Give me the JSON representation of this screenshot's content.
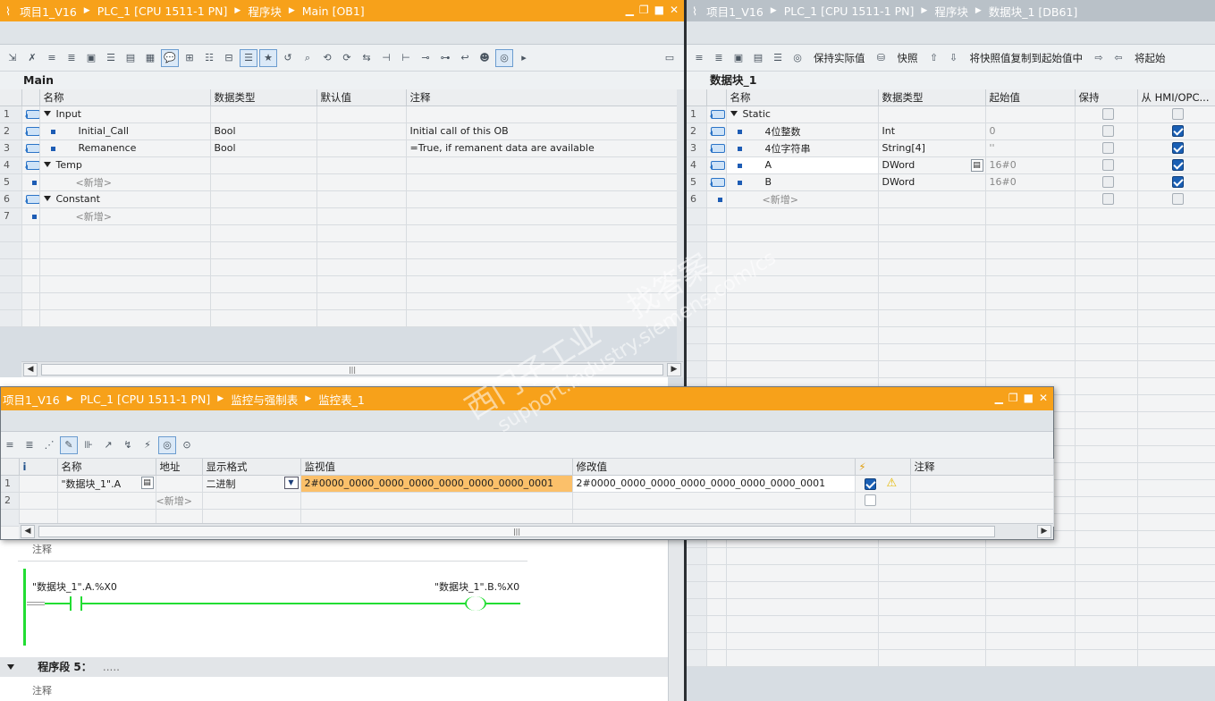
{
  "left_editor": {
    "breadcrumb": [
      "项目1_V16",
      "PLC_1 [CPU 1511-1 PN]",
      "程序块",
      "Main [OB1]"
    ],
    "block_name": "Main",
    "columns": [
      "名称",
      "数据类型",
      "默认值",
      "注释"
    ],
    "rows": [
      {
        "n": "1",
        "name": "Input",
        "type": "",
        "default": "",
        "comment": ""
      },
      {
        "n": "2",
        "name": "Initial_Call",
        "type": "Bool",
        "default": "",
        "comment": "Initial call of this OB"
      },
      {
        "n": "3",
        "name": "Remanence",
        "type": "Bool",
        "default": "",
        "comment": "=True, if remanent data are available"
      },
      {
        "n": "4",
        "name": "Temp",
        "type": "",
        "default": "",
        "comment": ""
      },
      {
        "n": "5",
        "name": "<新增>",
        "type": "",
        "default": "",
        "comment": ""
      },
      {
        "n": "6",
        "name": "Constant",
        "type": "",
        "default": "",
        "comment": ""
      },
      {
        "n": "7",
        "name": "<新增>",
        "type": "",
        "default": "",
        "comment": ""
      }
    ]
  },
  "right_editor": {
    "breadcrumb": [
      "项目1_V16",
      "PLC_1 [CPU 1511-1 PN]",
      "程序块",
      "数据块_1 [DB61]"
    ],
    "toolbar": {
      "keep_actual": "保持实际值",
      "snapshot": "快照",
      "copy_snapshot": "将快照值复制到起始值中",
      "load_start": "将起始"
    },
    "block_name": "数据块_1",
    "columns": [
      "名称",
      "数据类型",
      "起始值",
      "保持",
      "从 HMI/OPC..."
    ],
    "rows": [
      {
        "n": "1",
        "name": "Static",
        "type": "",
        "start": "",
        "keep": "false",
        "hmi": "false"
      },
      {
        "n": "2",
        "name": "4位整数",
        "type": "Int",
        "start": "0",
        "keep": "false",
        "hmi": "true"
      },
      {
        "n": "3",
        "name": "4位字符串",
        "type": "String[4]",
        "start": "''",
        "keep": "false",
        "hmi": "true"
      },
      {
        "n": "4",
        "name": "A",
        "type": "DWord",
        "start": "16#0",
        "keep": "false",
        "hmi": "true"
      },
      {
        "n": "5",
        "name": "B",
        "type": "DWord",
        "start": "16#0",
        "keep": "false",
        "hmi": "true"
      },
      {
        "n": "6",
        "name": "<新增>",
        "type": "",
        "start": "",
        "keep": "false",
        "hmi": "false"
      }
    ]
  },
  "watch_table": {
    "breadcrumb": [
      "项目1_V16",
      "PLC_1 [CPU 1511-1 PN]",
      "监控与强制表",
      "监控表_1"
    ],
    "columns": [
      "i",
      "名称",
      "地址",
      "显示格式",
      "监视值",
      "修改值",
      "⚡",
      "注释"
    ],
    "rows": [
      {
        "n": "1",
        "name": "\"数据块_1\".A",
        "address": "",
        "format": "二进制",
        "monitor": "2#0000_0000_0000_0000_0000_0000_0000_0001",
        "modify": "2#0000_0000_0000_0000_0000_0000_0000_0001",
        "comment": ""
      },
      {
        "n": "2",
        "name": "",
        "address": "<新增>",
        "format": "",
        "monitor": "",
        "modify": "",
        "comment": ""
      }
    ]
  },
  "ladder": {
    "comment_label": "注释",
    "contact_left": "\"数据块_1\".A.%X0",
    "coil_right": "\"数据块_1\".B.%X0",
    "network_title": "程序段 5：",
    "network_dots": ".....",
    "comment_label2": "注释"
  },
  "watermark": {
    "line1": "西门子工业",
    "line2": "找答案",
    "line3": "support.industry.siemens.com/cs"
  },
  "colors": {
    "title_active": "#f7a11a",
    "title_inactive": "#b9c1c8",
    "monitor_bg": "#fbc06a",
    "ladder_green": "#22dd33"
  }
}
